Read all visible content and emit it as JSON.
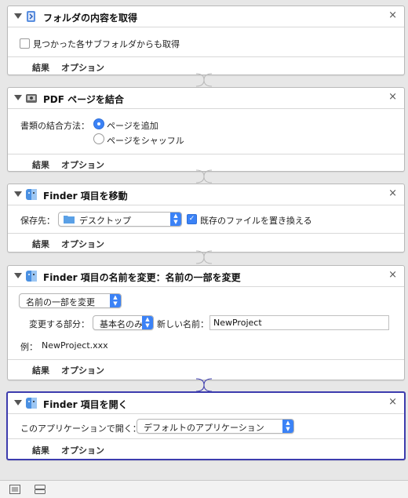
{
  "actions": [
    {
      "title": "フォルダの内容を取得",
      "checkbox_label": "見つかった各サブフォルダからも取得",
      "results_label": "結果",
      "options_label": "オプション"
    },
    {
      "title": "PDF ページを結合",
      "combine_label": "書類の結合方法：",
      "radio_append": "ページを追加",
      "radio_shuffle": "ページをシャッフル",
      "results_label": "結果",
      "options_label": "オプション"
    },
    {
      "title": "Finder 項目を移動",
      "save_label": "保存先：",
      "destination_value": "デスクトップ",
      "replace_label": "既存のファイルを置き換える",
      "results_label": "結果",
      "options_label": "オプション"
    },
    {
      "title": "Finder 項目の名前を変更：名前の一部を変更",
      "mode_value": "名前の一部を変更",
      "part_label": "変更する部分：",
      "part_value": "基本名のみ",
      "new_name_label": "新しい名前：",
      "new_name_value": "NewProject",
      "example_label": "例：",
      "example_value": "NewProject.xxx",
      "results_label": "結果",
      "options_label": "オプション"
    },
    {
      "title": "Finder 項目を開く",
      "open_with_label": "このアプリケーションで開く：",
      "app_value": "デフォルトのアプリケーション",
      "results_label": "結果",
      "options_label": "オプション"
    }
  ],
  "colors": {
    "accent": "#3b82f6",
    "selection_border": "#3d3cae"
  },
  "icons": {
    "close": "×",
    "collapse": "disclosure-triangle"
  }
}
